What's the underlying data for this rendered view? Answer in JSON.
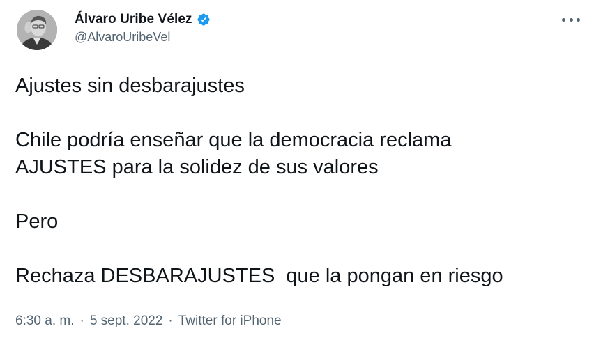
{
  "author": {
    "display_name": "Álvaro Uribe Vélez",
    "handle": "@AlvaroUribeVel",
    "verified": true
  },
  "tweet": {
    "lines": [
      "Ajustes sin desbarajustes",
      "Chile podría enseñar que la democracia reclama",
      "AJUSTES para la solidez de sus valores",
      "Pero",
      "Rechaza DESBARAJUSTES  que la pongan en riesgo"
    ]
  },
  "meta": {
    "time": "6:30 a. m.",
    "separator": "·",
    "date": "5 sept. 2022",
    "source": "Twitter for iPhone"
  },
  "colors": {
    "text": "#0f1419",
    "secondary": "#536471",
    "verified": "#1d9bf0"
  },
  "icons": {
    "verified": "verified-badge-icon",
    "more": "more-options-icon"
  }
}
